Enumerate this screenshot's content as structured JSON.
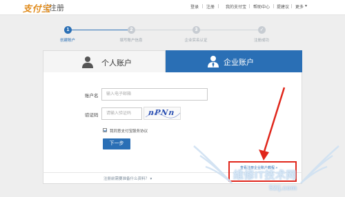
{
  "header": {
    "logo_text": "支付宝",
    "page_title": "注册",
    "nav": [
      "登录",
      "注册",
      "我的支付宝",
      "帮助中心",
      "提建议",
      "更多"
    ]
  },
  "steps": [
    {
      "number": "1",
      "label": "创建账户",
      "active": true
    },
    {
      "number": "2",
      "label": "填写账户信息",
      "active": false
    },
    {
      "number": "3",
      "label": "企业实名认证",
      "active": false
    },
    {
      "number": "✓",
      "label": "注册成功",
      "active": false
    }
  ],
  "tabs": {
    "personal_label": "个人账户",
    "enterprise_label": "企业账户",
    "selected": "enterprise"
  },
  "form": {
    "account_label": "账户名",
    "account_placeholder": "输入电子邮箱",
    "captcha_label": "验证码",
    "captcha_placeholder": "请输入验证码",
    "captcha_image_text": "nPNn",
    "agree_checked": true,
    "agree_text": "我同意支付宝服务协议",
    "submit_label": "下一步"
  },
  "footer": {
    "link_text": "注册前需要准备什么资料？ ▾",
    "hint_text": "查看注册企业账户教程 »"
  },
  "annotation": {
    "color": "#e0261b"
  },
  "watermark": {
    "text": "维修IT技术网",
    "url": "52ij.com"
  },
  "colors": {
    "brand_blue": "#2a6fb5",
    "logo_orange": "#e08a1a"
  }
}
